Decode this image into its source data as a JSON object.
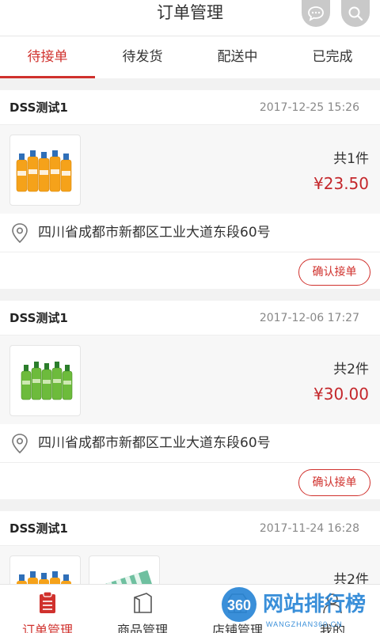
{
  "header": {
    "title": "订单管理",
    "message_icon": "message-icon",
    "search_icon": "search-icon"
  },
  "tabs": [
    {
      "label": "待接单",
      "active": true
    },
    {
      "label": "待发货",
      "active": false
    },
    {
      "label": "配送中",
      "active": false
    },
    {
      "label": "已完成",
      "active": false
    }
  ],
  "orders": [
    {
      "shop": "DSS测试1",
      "time": "2017-12-25 15:26",
      "count": "共1件",
      "price": "¥23.50",
      "address": "四川省成都市新都区工业大道东段60号",
      "action": "确认接单"
    },
    {
      "shop": "DSS测试1",
      "time": "2017-12-06 17:27",
      "count": "共2件",
      "price": "¥30.00",
      "address": "四川省成都市新都区工业大道东段60号",
      "action": "确认接单"
    },
    {
      "shop": "DSS测试1",
      "time": "2017-11-24 16:28",
      "count": "共2件"
    }
  ],
  "bottom_nav": [
    {
      "label": "订单管理",
      "icon": "orders-icon",
      "active": true
    },
    {
      "label": "商品管理",
      "icon": "goods-icon",
      "active": false
    },
    {
      "label": "店铺管理",
      "icon": "store-icon",
      "active": false
    },
    {
      "label": "我的",
      "icon": "profile-icon",
      "active": false
    }
  ],
  "watermark": {
    "number": "360",
    "text": "网站排行榜",
    "url": "WANGZHAN360.CN"
  },
  "colors": {
    "accent": "#d0312d",
    "price": "#c4272b",
    "background": "#f2f2f2"
  }
}
